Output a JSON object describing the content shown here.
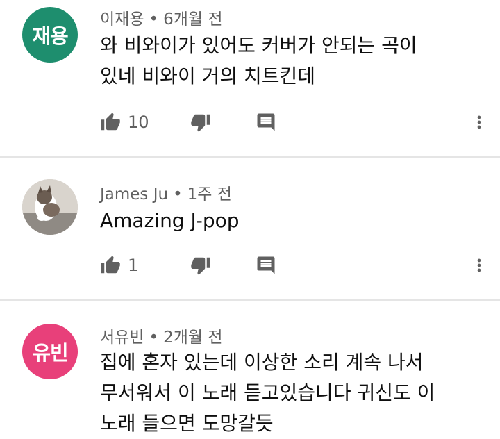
{
  "comments": [
    {
      "avatar_text": "재용",
      "avatar_color": "#1e8e6e",
      "author": "이재용",
      "time": "6개월 전",
      "lines": [
        "와 비와이가 있어도 커버가 안되는 곡이",
        "있네 비와이 거의 치트킨데"
      ],
      "likes": "10"
    },
    {
      "avatar_text": "",
      "avatar_color": "#cfc9c2",
      "author": "James Ju",
      "time": "1주 전",
      "lines": [
        "Amazing J-pop"
      ],
      "likes": "1"
    },
    {
      "avatar_text": "유빈",
      "avatar_color": "#e8407a",
      "author": "서유빈",
      "time": "2개월 전",
      "lines": [
        "집에 혼자 있는데 이상한 소리 계속 나서",
        "무서워서 이 노래 듣고있습니다 귀신도 이",
        "노래 들으면 도망갈듯"
      ],
      "likes": ""
    }
  ],
  "icons": {
    "like": "thumb-up-icon",
    "dislike": "thumb-down-icon",
    "reply": "reply-comment-icon",
    "more": "more-vert-icon"
  },
  "meta_separator": "•",
  "colors": {
    "secondary_text": "#606060",
    "icon": "#606060",
    "divider": "#e5e5e5"
  }
}
